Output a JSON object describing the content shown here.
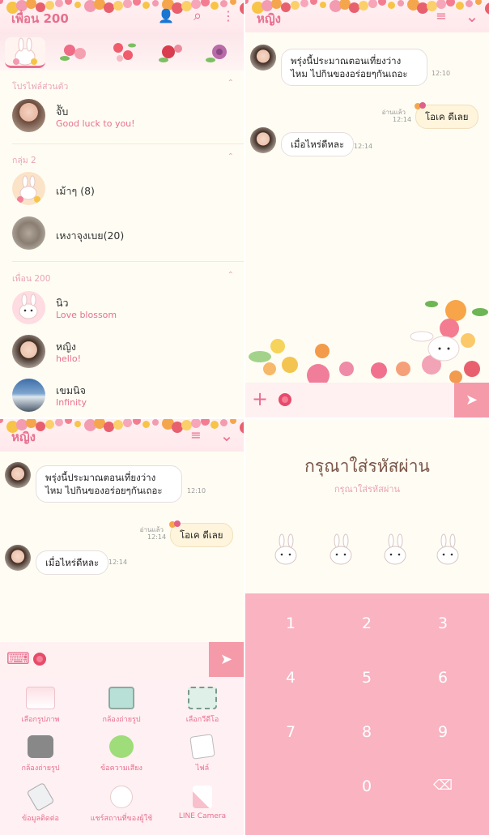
{
  "colors": {
    "accent": "#e86f8e",
    "pink_bg": "#f9b3c1",
    "cream_bg": "#fffdf3",
    "send": "#f59aa8"
  },
  "friends_panel": {
    "title": "เพื่อน 200",
    "icons": [
      "add-friend-icon",
      "search-icon",
      "more-icon"
    ],
    "tabs": [
      "bunny-profile-tab",
      "flower-tab-1",
      "flower-tab-2",
      "flower-tab-3",
      "flower-tab-4"
    ],
    "sections": [
      {
        "label": "โปรไฟล์ส่วนตัว"
      },
      {
        "label": "กลุ่ม 2"
      },
      {
        "label": "เพื่อน 200"
      }
    ],
    "profile": {
      "name": "จ๊ับ",
      "status": "Good luck to you!"
    },
    "groups": [
      {
        "name": "เม้าๆ (8)"
      },
      {
        "name": "เหงาจุงเบย(20)"
      }
    ],
    "friends": [
      {
        "name": "นิว",
        "status": "Love blossom"
      },
      {
        "name": "หญิง",
        "status": "hello!"
      },
      {
        "name": "เขมนิจ",
        "status": "Infinity"
      }
    ]
  },
  "chat": {
    "title": "หญิง",
    "icons": [
      "menu-icon",
      "chevron-down-icon"
    ],
    "messages": [
      {
        "text": "พรุ่งนี้ประมาณตอนเที่ยงว่างไหม ไปกินของอร่อยๆกันเถอะ",
        "time": "12:10"
      },
      {
        "text": "โอเค ดีเลย",
        "time": "12:14",
        "read": "อ่านแล้ว"
      },
      {
        "text": "เมื่อไหร่ดีหละ",
        "time": "12:14"
      }
    ]
  },
  "attach_menu": [
    {
      "label": "เลือกรูปภาพ",
      "icon": "photo-icon"
    },
    {
      "label": "กล้องถ่ายรูป",
      "icon": "camera-icon"
    },
    {
      "label": "เลือกวีดีโอ",
      "icon": "video-icon"
    },
    {
      "label": "กล้องถ่ายรูป",
      "icon": "video-camera-icon"
    },
    {
      "label": "ข้อความเสียง",
      "icon": "frog-voice-icon"
    },
    {
      "label": "ไฟล์",
      "icon": "file-icon"
    },
    {
      "label": "ข้อมูลติดต่อ",
      "icon": "contact-icon"
    },
    {
      "label": "แชร์สถานที่ของผู้ใช้",
      "icon": "location-bunny-icon"
    },
    {
      "label": "LINE Camera",
      "icon": "line-camera-icon"
    }
  ],
  "passcode": {
    "title": "กรุณาใส่รหัสผ่าน",
    "subtitle": "กรุณาใส่รหัสผ่าน",
    "keys": [
      "1",
      "2",
      "3",
      "4",
      "5",
      "6",
      "7",
      "8",
      "9",
      "0"
    ],
    "delete_icon": "backspace-icon"
  },
  "glyphs": {
    "chev": "⌃",
    "down": "⌄",
    "plus": "+",
    "send": "➤",
    "menu": "≡",
    "dots": "⋮",
    "search": "⌕",
    "addfriend": "👤",
    "del": "⌫",
    "keyboard": "⌨"
  }
}
